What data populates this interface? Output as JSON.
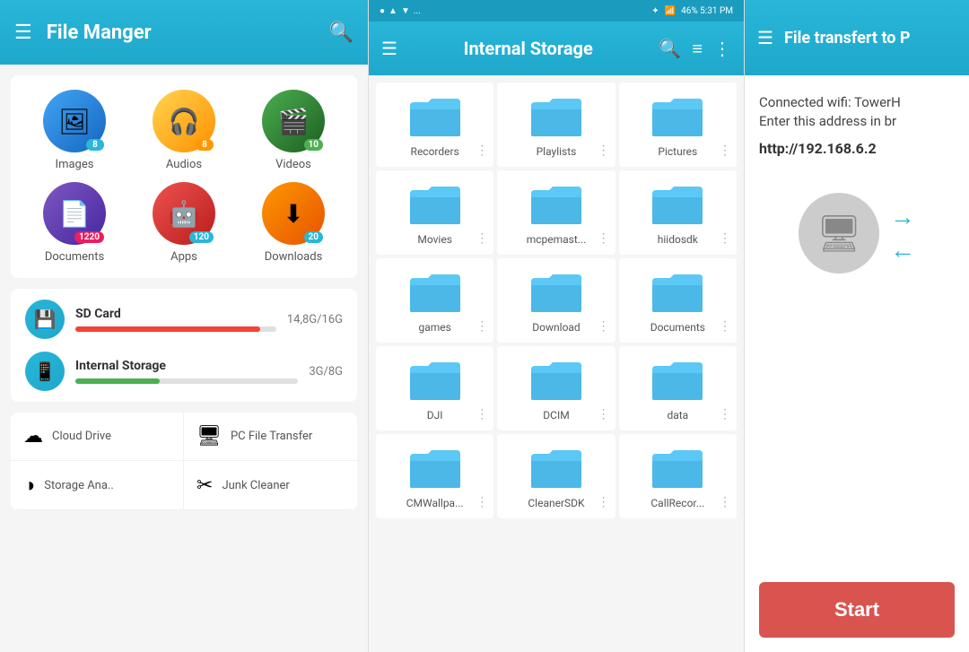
{
  "panel1": {
    "title": "File Manger",
    "grid_items": [
      {
        "id": "images",
        "label": "Images",
        "badge": "8",
        "badge_color": "blue",
        "icon_class": "icon-images",
        "icon": "🖼"
      },
      {
        "id": "audios",
        "label": "Audios",
        "badge": "8",
        "badge_color": "orange",
        "icon_class": "icon-audios",
        "icon": "🎧"
      },
      {
        "id": "videos",
        "label": "Videos",
        "badge": "10",
        "badge_color": "green",
        "icon_class": "icon-videos",
        "icon": "🎬"
      },
      {
        "id": "documents",
        "label": "Documents",
        "badge": "1220",
        "badge_color": "pink",
        "icon_class": "icon-documents",
        "icon": "📄"
      },
      {
        "id": "apps",
        "label": "Apps",
        "badge": "120",
        "badge_color": "blue",
        "icon_class": "icon-apps",
        "icon": "🤖"
      },
      {
        "id": "downloads",
        "label": "Downloads",
        "badge": "20",
        "badge_color": "blue",
        "icon_class": "icon-downloads",
        "icon": "⬇"
      }
    ],
    "storage_items": [
      {
        "id": "sd-card",
        "label": "SD Card",
        "size": "14,8G/16G",
        "fill_percent": 92,
        "bar_color": "red",
        "icon": "💾"
      },
      {
        "id": "internal",
        "label": "Internal Storage",
        "size": "3G/8G",
        "fill_percent": 38,
        "bar_color": "green",
        "icon": "📱"
      }
    ],
    "menu_items": [
      {
        "id": "cloud-drive",
        "label": "Cloud Drive",
        "icon": "☁"
      },
      {
        "id": "pc-file-transfer",
        "label": "PC File Transfer",
        "icon": "🖥"
      },
      {
        "id": "storage-analyzer",
        "label": "Storage Ana..",
        "icon": "◑"
      },
      {
        "id": "junk-cleaner",
        "label": "Junk Cleaner",
        "icon": "✂"
      }
    ]
  },
  "panel2": {
    "title": "Internal Storage",
    "statusbar": {
      "left": "● ▲ ▼ ...",
      "right": "46% 5:31 PM"
    },
    "folders": [
      {
        "name": "Recorders"
      },
      {
        "name": "Playlists"
      },
      {
        "name": "Pictures"
      },
      {
        "name": "Movies"
      },
      {
        "name": "mcpemast..."
      },
      {
        "name": "hiidosdk"
      },
      {
        "name": "games"
      },
      {
        "name": "Download"
      },
      {
        "name": "Documents"
      },
      {
        "name": "DJI"
      },
      {
        "name": "DCIM"
      },
      {
        "name": "data"
      },
      {
        "name": "CMWallpa..."
      },
      {
        "name": "CleanerSDK"
      },
      {
        "name": "CallRecor..."
      }
    ]
  },
  "panel3": {
    "title": "File transfert to P",
    "connection_text": "Connected wifi: TowerH\nEnter this address in br",
    "url": "http://192.168.6.2",
    "start_label": "Start"
  }
}
